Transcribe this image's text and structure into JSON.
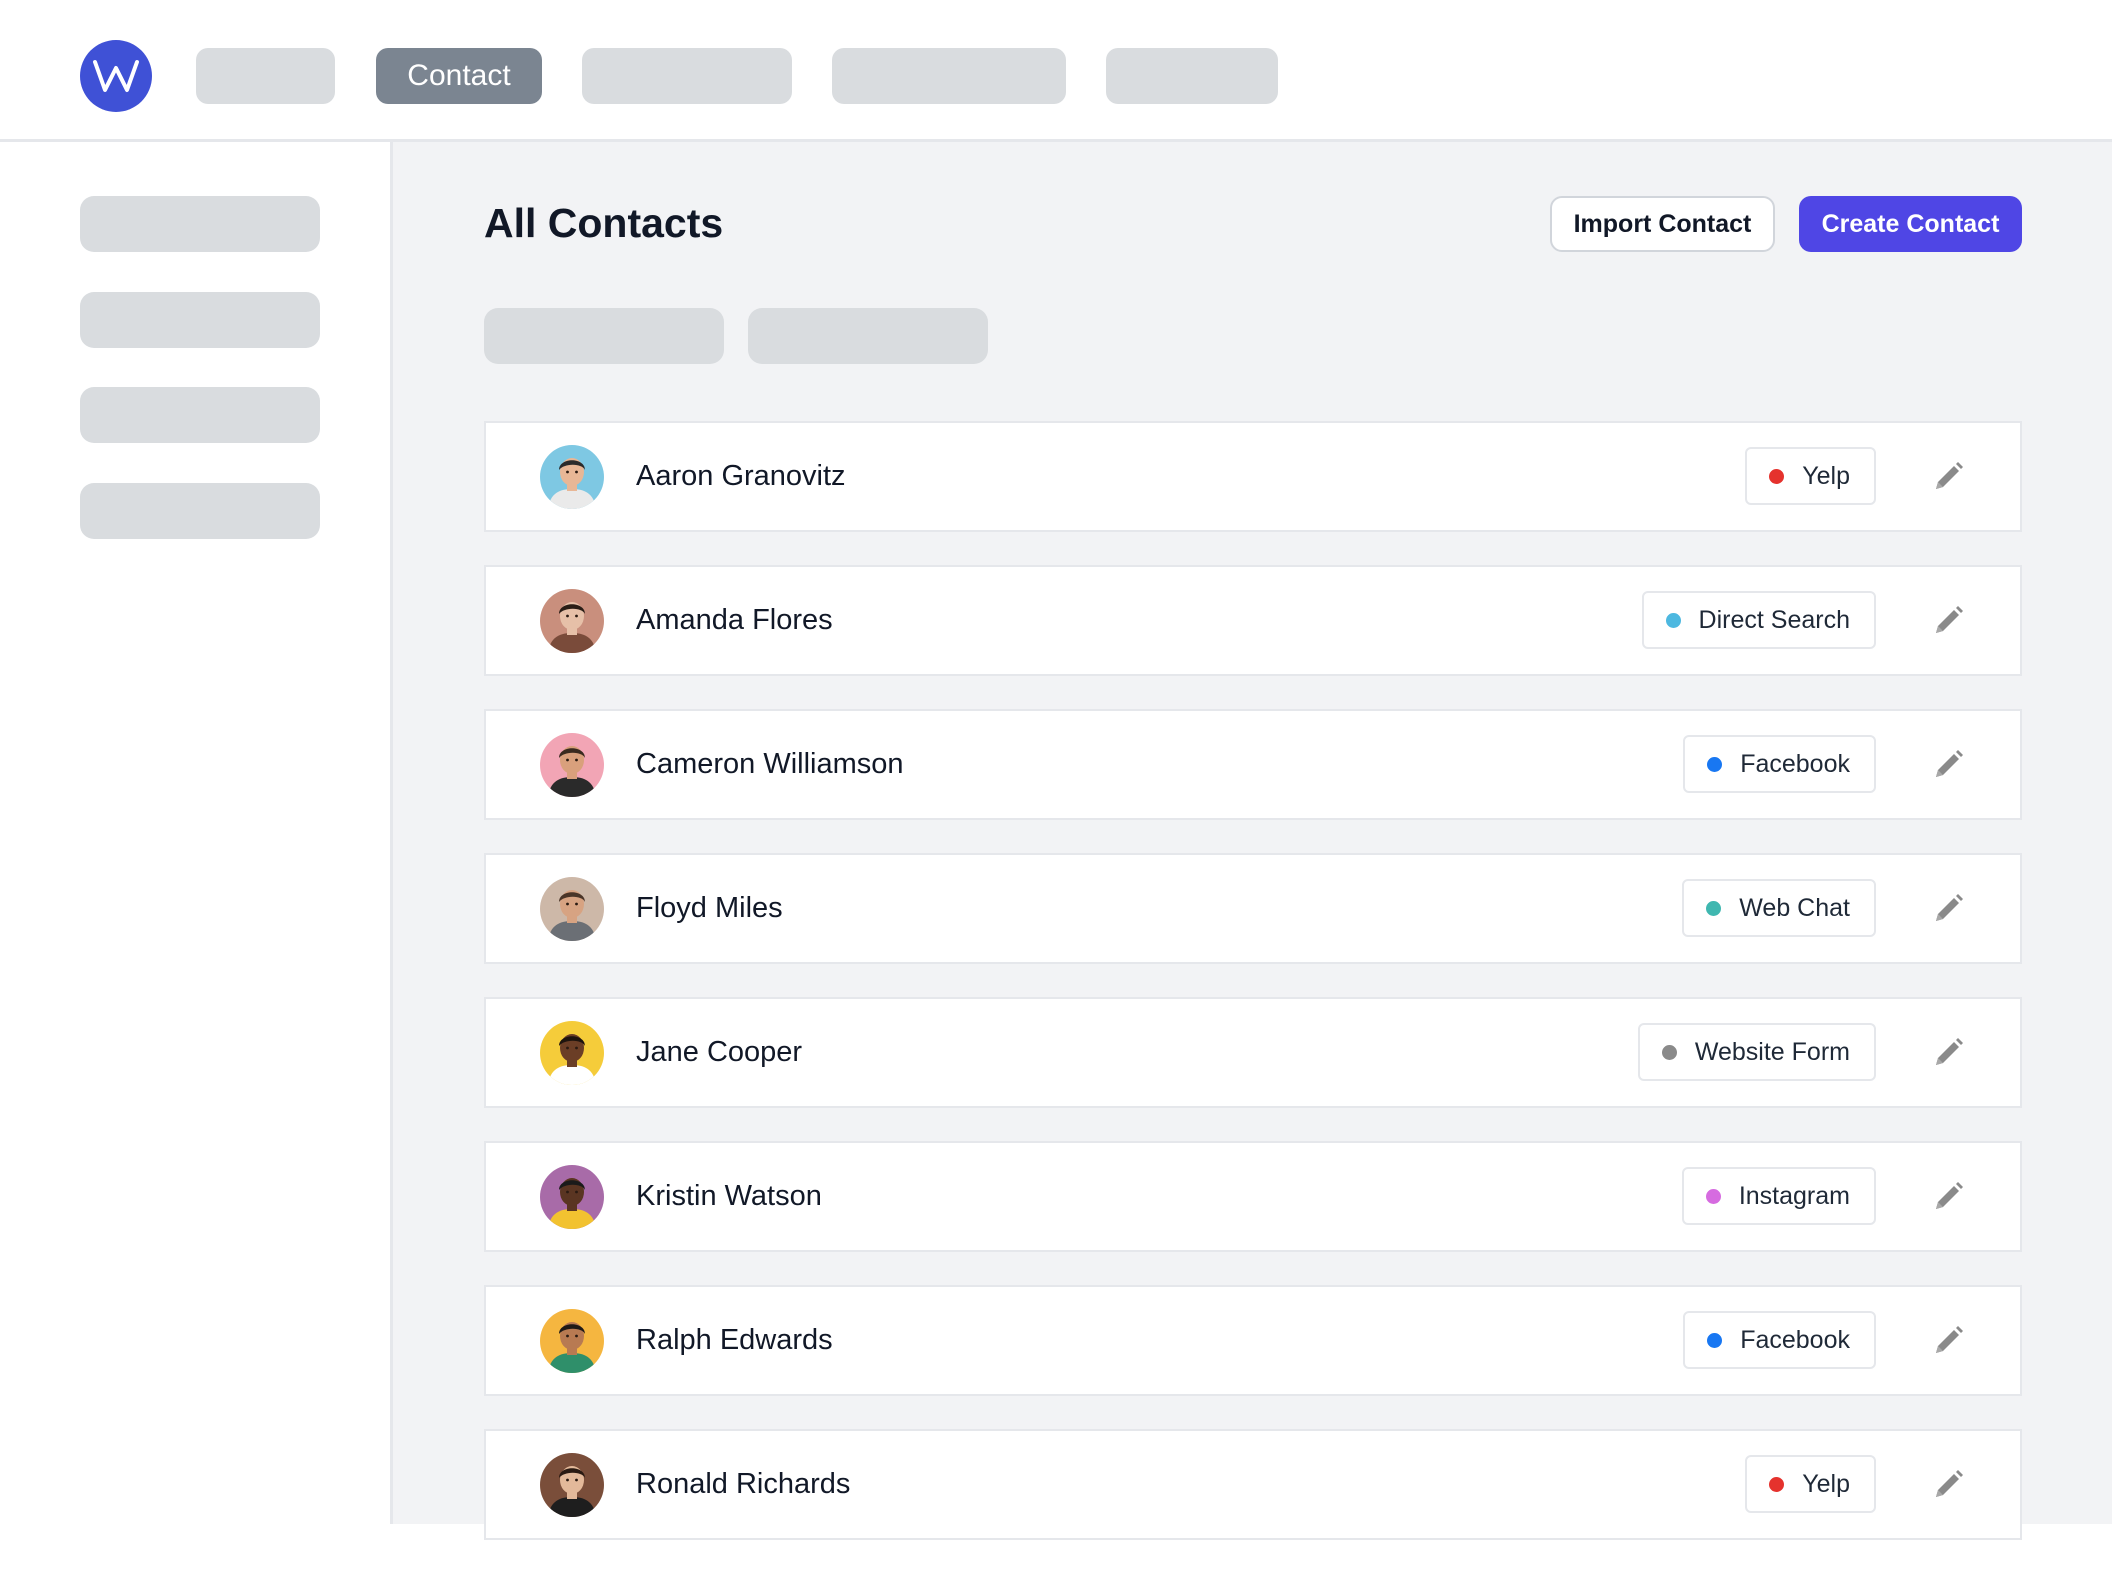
{
  "nav": {
    "active_label": "Contact"
  },
  "page": {
    "title": "All Contacts",
    "import_label": "Import Contact",
    "create_label": "Create Contact"
  },
  "colors": {
    "brand": "#3f51d6",
    "primary_button": "#4f46e5"
  },
  "contacts": [
    {
      "name": "Aaron Granovitz",
      "source": "Yelp",
      "dot": "#e5322d",
      "avatar_bg": "#7ec8e3",
      "skin": "#e8b796",
      "hair": "#2b2b2b",
      "shirt": "#eaeaea"
    },
    {
      "name": "Amanda Flores",
      "source": "Direct Search",
      "dot": "#4db8e0",
      "avatar_bg": "#c98f7d",
      "skin": "#e6c0a8",
      "hair": "#2a1d16",
      "shirt": "#7a4b3a"
    },
    {
      "name": "Cameron Williamson",
      "source": "Facebook",
      "dot": "#1877f2",
      "avatar_bg": "#f2a5b5",
      "skin": "#d9a07c",
      "hair": "#3a2a1f",
      "shirt": "#2a2a2a"
    },
    {
      "name": "Floyd Miles",
      "source": "Web Chat",
      "dot": "#3fb7b0",
      "avatar_bg": "#cdb8a8",
      "skin": "#d7a382",
      "hair": "#4a3528",
      "shirt": "#6b6f75"
    },
    {
      "name": "Jane Cooper",
      "source": "Website Form",
      "dot": "#8a8a8a",
      "avatar_bg": "#f5cc3a",
      "skin": "#6b3e26",
      "hair": "#1e140e",
      "shirt": "#ffffff"
    },
    {
      "name": "Kristin Watson",
      "source": "Instagram",
      "dot": "#d66be0",
      "avatar_bg": "#a86ba8",
      "skin": "#5a3522",
      "hair": "#1a1a1a",
      "shirt": "#f2c230"
    },
    {
      "name": "Ralph Edwards",
      "source": "Facebook",
      "dot": "#1877f2",
      "avatar_bg": "#f5b640",
      "skin": "#b87a52",
      "hair": "#1f1a17",
      "shirt": "#2f8f6a"
    },
    {
      "name": "Ronald Richards",
      "source": "Yelp",
      "dot": "#e5322d",
      "avatar_bg": "#7a4e3a",
      "skin": "#e3b99a",
      "hair": "#2a1a12",
      "shirt": "#1e1e1e"
    }
  ]
}
